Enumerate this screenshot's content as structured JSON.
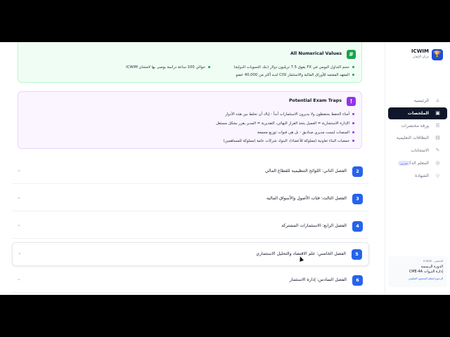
{
  "brand": {
    "logo": "🏆",
    "name": "ICWIM",
    "subtitle": "مركز الإتقان"
  },
  "nav": [
    {
      "label": "الرئيسية",
      "icon": "⌂",
      "active": false
    },
    {
      "label": "الملخصات",
      "icon": "▣",
      "active": true
    },
    {
      "label": "ورقة مختصرات",
      "icon": "☰",
      "active": false
    },
    {
      "label": "البطاقات التعليمية",
      "icon": "▤",
      "active": false
    },
    {
      "label": "الامتحانات",
      "icon": "✎",
      "active": false
    },
    {
      "label": "المعلم الذكي",
      "icon": "◎",
      "active": false,
      "badge": "تجريبي"
    },
    {
      "label": "الشهادة",
      "icon": "◇",
      "active": false
    }
  ],
  "sidebar_card": {
    "line1": "التحضير - ICWIM",
    "line2": "الدورة الرسمية",
    "line3": "إدارة الثروات CME-4A",
    "line4": "الرجوع لمعلم المحتوى التعليمي"
  },
  "numerical": {
    "icon": "#",
    "title": "All Numerical Values",
    "items": [
      "حجم التداول اليومي في FX يفوق 7.5 تريليون دولار (بنك التسويات الدولية)",
      "المعهد المعتمد للأوراق المالية والاستثمار CISI لديه أكثر من 40,000 عضو",
      "حوالي 100 ساعة دراسة يوصى بها لامتحان ICWIM"
    ]
  },
  "traps": {
    "icon": "!",
    "title": "Potential Exam Traps",
    "items": [
      "أمناء الحفظ يحتفظون ولا يديرون الاستثمارات أبداً - إياك أن تخلط بين هذه الأدوار",
      "الإدارة الاستشارية = العميل يتخذ القرار النهائي، التقديرية = المدير يقرر بشكل مستقل",
      "المنصات ليست مديري صناديق - بل هي قنوات توزيع مجمعة",
      "جمعيات البناء تعاونية (مملوكة للأعضاء)، البنوك شركات عامة (مملوكة للمساهمين)"
    ]
  },
  "chapters": [
    {
      "num": "2",
      "title": "الفصل الثاني: اللوائح التنظيمية للقطاع المالي"
    },
    {
      "num": "3",
      "title": "الفصل الثالث: فئات الأصول والأسواق المالية"
    },
    {
      "num": "4",
      "title": "الفصل الرابع: الاستثمارات المشتركة"
    },
    {
      "num": "5",
      "title": "الفصل الخامس: علم الاقتصاد والتحليل الاستثماري"
    },
    {
      "num": "6",
      "title": "الفصل السادس: إدارة الاستثمار"
    }
  ],
  "chevron": "⌄"
}
